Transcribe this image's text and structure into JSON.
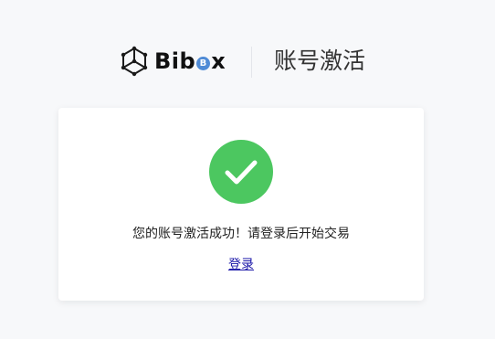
{
  "header": {
    "logo_text_prefix": "Bib",
    "logo_coin_glyph": "B",
    "logo_text_suffix": "x",
    "title": "账号激活"
  },
  "card": {
    "message": "您的账号激活成功！请登录后开始交易",
    "login_link": "登录"
  },
  "colors": {
    "success": "#4cc760",
    "link": "#1a16a8",
    "brand_coin": "#4f8bd6",
    "background": "#f7f8fa"
  },
  "icons": {
    "logo": "bibox-cube-logo",
    "status": "success-check-icon"
  }
}
